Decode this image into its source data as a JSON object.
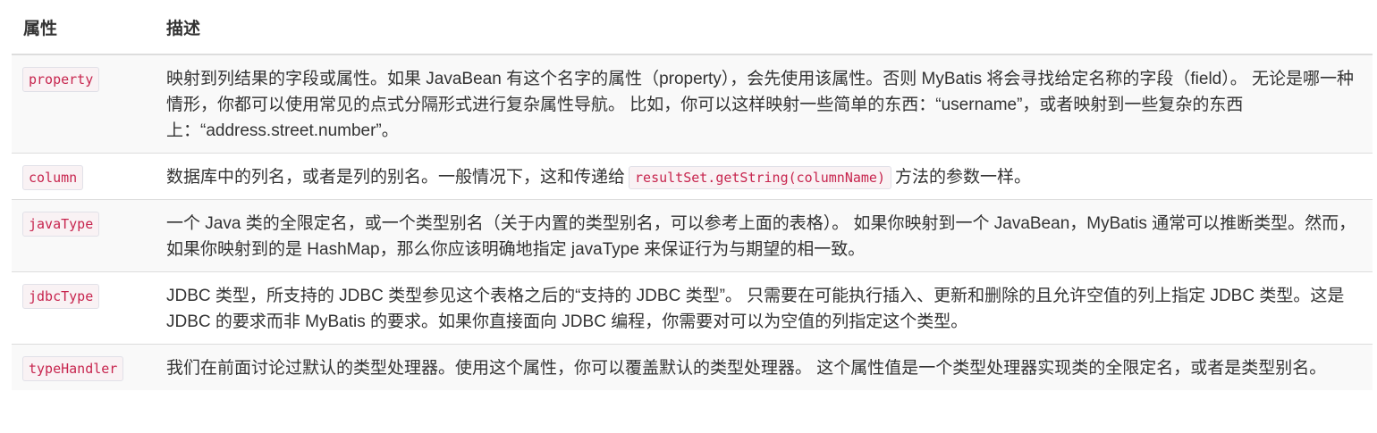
{
  "header": {
    "attr": "属性",
    "desc": "描述"
  },
  "rows": [
    {
      "attr": "property",
      "desc": "映射到列结果的字段或属性。如果 JavaBean 有这个名字的属性（property），会先使用该属性。否则 MyBatis 将会寻找给定名称的字段（field）。 无论是哪一种情形，你都可以使用常见的点式分隔形式进行复杂属性导航。 比如，你可以这样映射一些简单的东西：“username”，或者映射到一些复杂的东西上：“address.street.number”。"
    },
    {
      "attr": "column",
      "desc_before": "数据库中的列名，或者是列的别名。一般情况下，这和传递给",
      "desc_code": "resultSet.getString(columnName)",
      "desc_after": "方法的参数一样。"
    },
    {
      "attr": "javaType",
      "desc": "一个 Java 类的全限定名，或一个类型别名（关于内置的类型别名，可以参考上面的表格）。 如果你映射到一个 JavaBean，MyBatis 通常可以推断类型。然而，如果你映射到的是 HashMap，那么你应该明确地指定 javaType 来保证行为与期望的相一致。"
    },
    {
      "attr": "jdbcType",
      "desc": "JDBC 类型，所支持的 JDBC 类型参见这个表格之后的“支持的 JDBC 类型”。 只需要在可能执行插入、更新和删除的且允许空值的列上指定 JDBC 类型。这是 JDBC 的要求而非 MyBatis 的要求。如果你直接面向 JDBC 编程，你需要对可以为空值的列指定这个类型。"
    },
    {
      "attr": "typeHandler",
      "desc": "我们在前面讨论过默认的类型处理器。使用这个属性，你可以覆盖默认的类型处理器。 这个属性值是一个类型处理器实现类的全限定名，或者是类型别名。"
    }
  ]
}
